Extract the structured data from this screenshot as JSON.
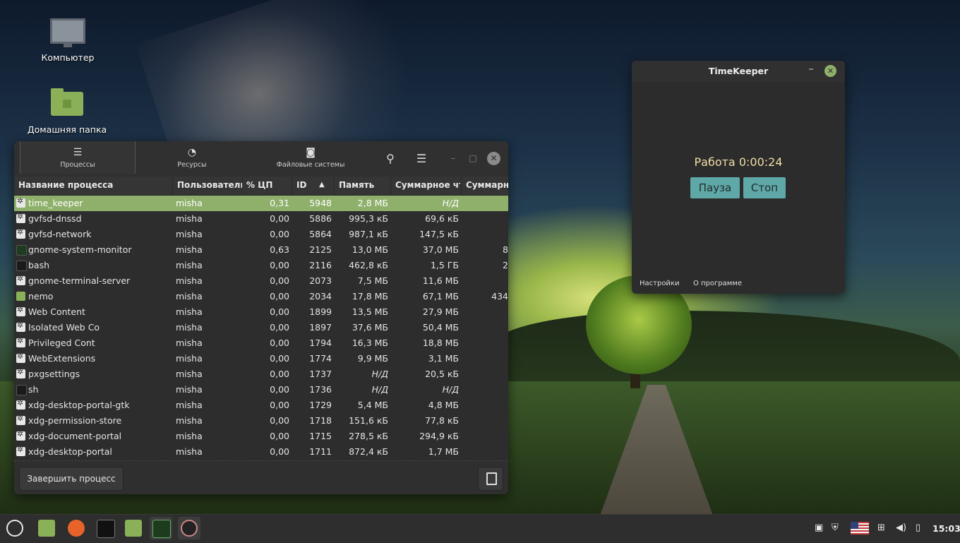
{
  "desktop": {
    "icons": [
      {
        "label": "Компьютер",
        "icon": "computer-icon"
      },
      {
        "label": "Домашняя папка",
        "icon": "home-folder-icon"
      }
    ]
  },
  "sysmon": {
    "tabs": [
      {
        "label": "Процессы",
        "icon": "processes-icon"
      },
      {
        "label": "Ресурсы",
        "icon": "resources-icon"
      },
      {
        "label": "Файловые системы",
        "icon": "filesystems-icon"
      }
    ],
    "columns": [
      "Название процесса",
      "Пользователь",
      "% ЦП",
      "ID",
      "Память",
      "Суммарное чт",
      "Суммарн"
    ],
    "sort_indicator": "▲",
    "rows": [
      {
        "name": "time_keeper",
        "user": "misha",
        "cpu": "0,31",
        "id": "5948",
        "mem": "2,8 МБ",
        "read": "Н/Д",
        "write": "",
        "icon": "gear"
      },
      {
        "name": "gvfsd-dnssd",
        "user": "misha",
        "cpu": "0,00",
        "id": "5886",
        "mem": "995,3 кБ",
        "read": "69,6 кБ",
        "write": "",
        "icon": "gear"
      },
      {
        "name": "gvfsd-network",
        "user": "misha",
        "cpu": "0,00",
        "id": "5864",
        "mem": "987,1 кБ",
        "read": "147,5 кБ",
        "write": "",
        "icon": "gear"
      },
      {
        "name": "gnome-system-monitor",
        "user": "misha",
        "cpu": "0,63",
        "id": "2125",
        "mem": "13,0 МБ",
        "read": "37,0 МБ",
        "write": "8",
        "icon": "sysm"
      },
      {
        "name": "bash",
        "user": "misha",
        "cpu": "0,00",
        "id": "2116",
        "mem": "462,8 кБ",
        "read": "1,5 ГБ",
        "write": "2",
        "icon": "term"
      },
      {
        "name": "gnome-terminal-server",
        "user": "misha",
        "cpu": "0,00",
        "id": "2073",
        "mem": "7,5 МБ",
        "read": "11,6 МБ",
        "write": "",
        "icon": "gear"
      },
      {
        "name": "nemo",
        "user": "misha",
        "cpu": "0,00",
        "id": "2034",
        "mem": "17,8 МБ",
        "read": "67,1 МБ",
        "write": "434",
        "icon": "fold"
      },
      {
        "name": "Web Content",
        "user": "misha",
        "cpu": "0,00",
        "id": "1899",
        "mem": "13,5 МБ",
        "read": "27,9 МБ",
        "write": "",
        "icon": "gear"
      },
      {
        "name": "Isolated Web Co",
        "user": "misha",
        "cpu": "0,00",
        "id": "1897",
        "mem": "37,6 МБ",
        "read": "50,4 МБ",
        "write": "",
        "icon": "gear"
      },
      {
        "name": "Privileged Cont",
        "user": "misha",
        "cpu": "0,00",
        "id": "1794",
        "mem": "16,3 МБ",
        "read": "18,8 МБ",
        "write": "",
        "icon": "gear"
      },
      {
        "name": "WebExtensions",
        "user": "misha",
        "cpu": "0,00",
        "id": "1774",
        "mem": "9,9 МБ",
        "read": "3,1 МБ",
        "write": "",
        "icon": "gear"
      },
      {
        "name": "pxgsettings",
        "user": "misha",
        "cpu": "0,00",
        "id": "1737",
        "mem": "Н/Д",
        "read": "20,5 кБ",
        "write": "",
        "icon": "gear"
      },
      {
        "name": "sh",
        "user": "misha",
        "cpu": "0,00",
        "id": "1736",
        "mem": "Н/Д",
        "read": "Н/Д",
        "write": "",
        "icon": "term"
      },
      {
        "name": "xdg-desktop-portal-gtk",
        "user": "misha",
        "cpu": "0,00",
        "id": "1729",
        "mem": "5,4 МБ",
        "read": "4,8 МБ",
        "write": "",
        "icon": "gear"
      },
      {
        "name": "xdg-permission-store",
        "user": "misha",
        "cpu": "0,00",
        "id": "1718",
        "mem": "151,6 кБ",
        "read": "77,8 кБ",
        "write": "",
        "icon": "gear"
      },
      {
        "name": "xdg-document-portal",
        "user": "misha",
        "cpu": "0,00",
        "id": "1715",
        "mem": "278,5 кБ",
        "read": "294,9 кБ",
        "write": "",
        "icon": "gear"
      },
      {
        "name": "xdg-desktop-portal",
        "user": "misha",
        "cpu": "0,00",
        "id": "1711",
        "mem": "872,4 кБ",
        "read": "1,7 МБ",
        "write": "",
        "icon": "gear"
      }
    ],
    "end_process_label": "Завершить процесс"
  },
  "timekeeper": {
    "title": "TimeKeeper",
    "status": "Работа 0:00:24",
    "pause_label": "Пауза",
    "stop_label": "Стоп",
    "settings_label": "Настройки",
    "about_label": "О программе"
  },
  "taskbar": {
    "clock": "15:03",
    "apps": [
      "menu-icon",
      "files-icon",
      "firefox-icon",
      "terminal-icon",
      "folder-icon",
      "system-monitor-icon",
      "timekeeper-icon"
    ],
    "tray": [
      "clipboard-icon",
      "shield-icon",
      "us-flag-icon",
      "network-icon",
      "volume-icon",
      "battery-icon"
    ]
  },
  "colors": {
    "accent": "#8fb06b",
    "button_teal": "#5fa8a8",
    "window_bg": "#2d2d2d",
    "status_text": "#f2dfa6"
  }
}
